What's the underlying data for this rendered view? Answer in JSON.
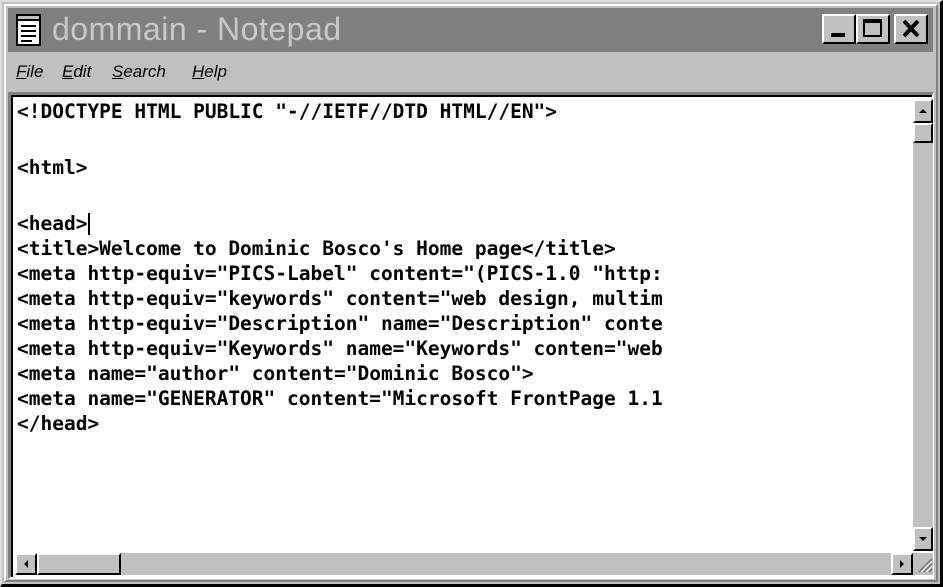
{
  "window": {
    "title": "dommain - Notepad"
  },
  "menu": {
    "items": [
      {
        "label": "File",
        "mnemonic": "F",
        "rest": "ile"
      },
      {
        "label": "Edit",
        "mnemonic": "E",
        "rest": "dit"
      },
      {
        "label": "Search",
        "mnemonic": "S",
        "rest": "earch"
      },
      {
        "label": "Help",
        "mnemonic": "H",
        "rest": "elp"
      }
    ]
  },
  "editor": {
    "lines": [
      "<!DOCTYPE HTML PUBLIC \"-//IETF//DTD HTML//EN\">",
      "",
      "<html>",
      "",
      "<head>",
      "<title>Welcome to Dominic Bosco's Home page</title>",
      "<meta http-equiv=\"PICS-Label\" content=\"(PICS-1.0 \"http:",
      "<meta http-equiv=\"keywords\" content=\"web design, multim",
      "<meta http-equiv=\"Description\" name=\"Description\" conte",
      "<meta http-equiv=\"Keywords\" name=\"Keywords\" conten=\"web",
      "<meta name=\"author\" content=\"Dominic Bosco\">",
      "<meta name=\"GENERATOR\" content=\"Microsoft FrontPage 1.1",
      "</head>"
    ],
    "caret_line": 4
  },
  "icons": {
    "app": "notepad-icon",
    "minimize": "minimize-icon",
    "maximize": "maximize-icon",
    "close": "close-icon",
    "scroll_up": "arrow-up-icon",
    "scroll_down": "arrow-down-icon",
    "scroll_left": "arrow-left-icon",
    "scroll_right": "arrow-right-icon",
    "grip": "resize-grip-icon"
  }
}
